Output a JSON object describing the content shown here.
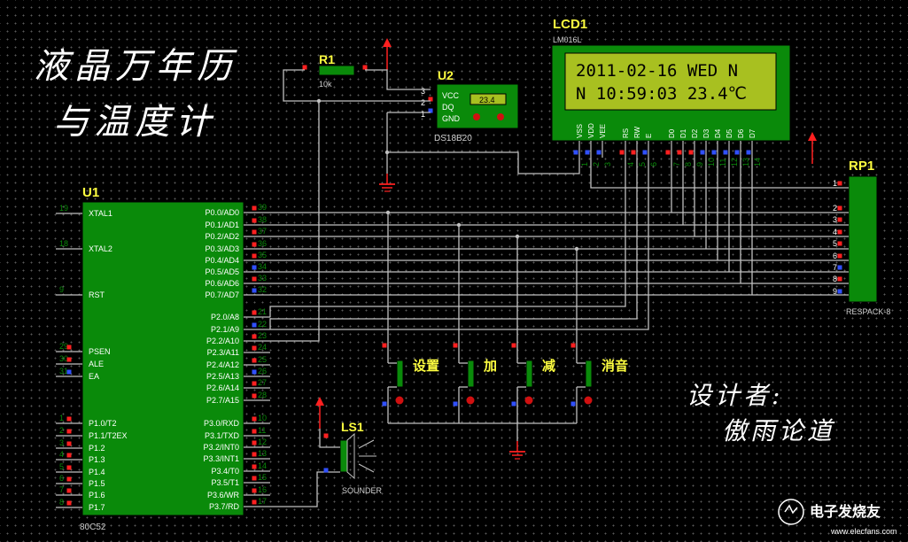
{
  "title": {
    "line1": "液晶万年历",
    "line2": "与温度计"
  },
  "designer": {
    "label": "设计者:",
    "name": "傲雨论道"
  },
  "watermark": {
    "text": "电子发烧友",
    "url": "www.elecfans.com"
  },
  "r1": {
    "ref": "R1",
    "value": "10k"
  },
  "u2": {
    "ref": "U2",
    "part": "DS18B20",
    "display": "23.4",
    "pins": {
      "vcc": "VCC",
      "dq": "DQ",
      "gnd": "GND",
      "n3": "3",
      "n2": "2",
      "n1": "1"
    }
  },
  "lcd": {
    "ref": "LCD1",
    "part": "LM016L",
    "line1": "2011-02-16  WED  N",
    "line2": "N  10:59:03  23.4℃",
    "pin_labels": [
      "VSS",
      "VDD",
      "VEE",
      "RS",
      "RW",
      "E",
      "D0",
      "D1",
      "D2",
      "D3",
      "D4",
      "D5",
      "D6",
      "D7"
    ],
    "pin_numbers": [
      "1",
      "2",
      "3",
      "4",
      "5",
      "6",
      "7",
      "8",
      "9",
      "10",
      "11",
      "12",
      "13",
      "14"
    ]
  },
  "rp1": {
    "ref": "RP1",
    "part": "RESPACK-8",
    "pins": [
      "1",
      "2",
      "3",
      "4",
      "5",
      "6",
      "7",
      "8",
      "9"
    ]
  },
  "u1": {
    "ref": "U1",
    "part": "80C52",
    "left_pins": [
      {
        "num": "19",
        "label": "XTAL1"
      },
      {
        "num": "18",
        "label": "XTAL2"
      },
      {
        "num": "9",
        "label": "RST"
      },
      {
        "num": "29",
        "label": "PSEN"
      },
      {
        "num": "30",
        "label": "ALE"
      },
      {
        "num": "31",
        "label": "EA"
      },
      {
        "num": "1",
        "label": "P1.0/T2"
      },
      {
        "num": "2",
        "label": "P1.1/T2EX"
      },
      {
        "num": "3",
        "label": "P1.2"
      },
      {
        "num": "4",
        "label": "P1.3"
      },
      {
        "num": "5",
        "label": "P1.4"
      },
      {
        "num": "6",
        "label": "P1.5"
      },
      {
        "num": "7",
        "label": "P1.6"
      },
      {
        "num": "8",
        "label": "P1.7"
      }
    ],
    "right_pins": [
      {
        "num": "39",
        "label": "P0.0/AD0"
      },
      {
        "num": "38",
        "label": "P0.1/AD1"
      },
      {
        "num": "37",
        "label": "P0.2/AD2"
      },
      {
        "num": "36",
        "label": "P0.3/AD3"
      },
      {
        "num": "35",
        "label": "P0.4/AD4"
      },
      {
        "num": "34",
        "label": "P0.5/AD5"
      },
      {
        "num": "33",
        "label": "P0.6/AD6"
      },
      {
        "num": "32",
        "label": "P0.7/AD7"
      },
      {
        "num": "21",
        "label": "P2.0/A8"
      },
      {
        "num": "22",
        "label": "P2.1/A9"
      },
      {
        "num": "23",
        "label": "P2.2/A10"
      },
      {
        "num": "24",
        "label": "P2.3/A11"
      },
      {
        "num": "25",
        "label": "P2.4/A12"
      },
      {
        "num": "26",
        "label": "P2.5/A13"
      },
      {
        "num": "27",
        "label": "P2.6/A14"
      },
      {
        "num": "28",
        "label": "P2.7/A15"
      },
      {
        "num": "10",
        "label": "P3.0/RXD"
      },
      {
        "num": "11",
        "label": "P3.1/TXD"
      },
      {
        "num": "12",
        "label": "P3.2/INT0"
      },
      {
        "num": "13",
        "label": "P3.3/INT1"
      },
      {
        "num": "14",
        "label": "P3.4/T0"
      },
      {
        "num": "15",
        "label": "P3.5/T1"
      },
      {
        "num": "16",
        "label": "P3.6/WR"
      },
      {
        "num": "17",
        "label": "P3.7/RD"
      }
    ]
  },
  "buttons": [
    {
      "label": "设置"
    },
    {
      "label": "加"
    },
    {
      "label": "减"
    },
    {
      "label": "消音"
    }
  ],
  "ls1": {
    "ref": "LS1",
    "part": "SOUNDER"
  },
  "colors": {
    "wire": "#c0c0c0",
    "component": "#0a8a0a",
    "component_border": "#000000",
    "ref": "#ffff40",
    "pin_red": "#ff2020",
    "pin_blue": "#3050ff",
    "power": "#ff2020",
    "lcd_screen": "#a8c020"
  }
}
